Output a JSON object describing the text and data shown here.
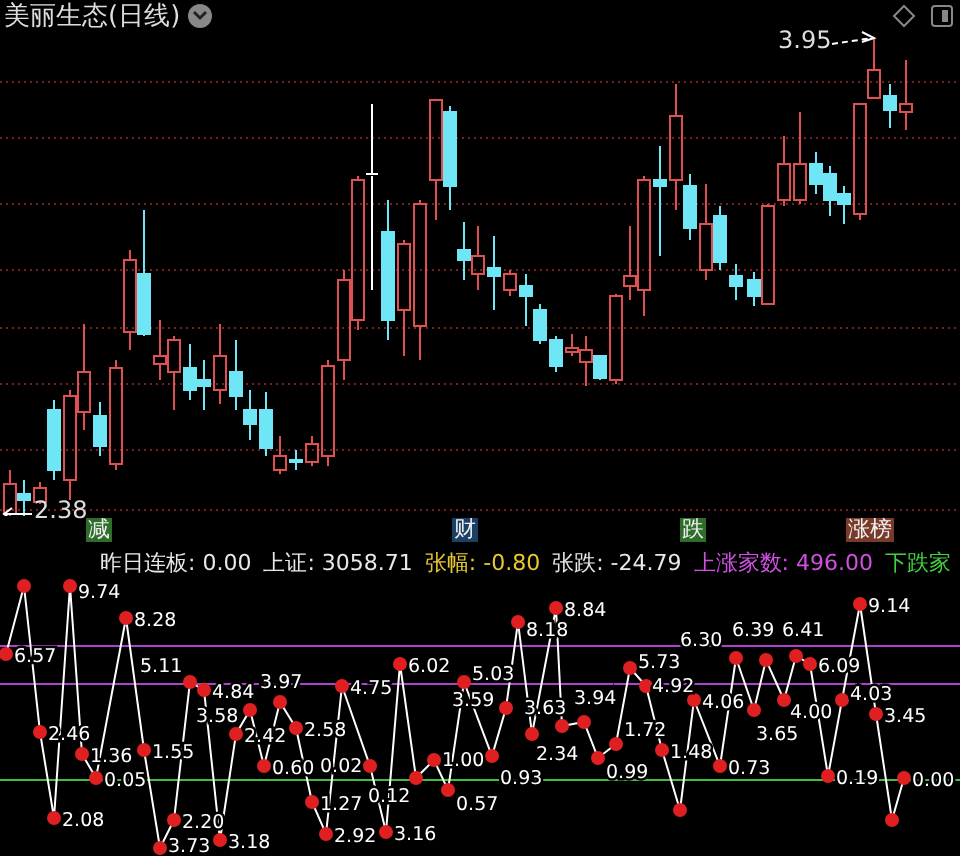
{
  "chart": {
    "title": "美丽生态(日线)",
    "high_label": "3.95",
    "low_label": "2.38"
  },
  "markers": [
    {
      "label": "减",
      "color": "#2f6e2a"
    },
    {
      "label": "财",
      "color": "#1c3f66"
    },
    {
      "label": "跌",
      "color": "#2f6e2a"
    },
    {
      "label": "涨榜",
      "color": "#7a3a2a"
    }
  ],
  "indicator": {
    "readouts": [
      {
        "text": "昨日连板: 0.00",
        "color": "#e8e8e8"
      },
      {
        "text": "上证: 3058.71",
        "color": "#e8e8e8"
      },
      {
        "text": "张幅: -0.80",
        "color": "#e8c830"
      },
      {
        "text": "张跌: -24.79",
        "color": "#e8e8e8"
      },
      {
        "text": "上涨家数: 496.00",
        "color": "#d050e0"
      },
      {
        "text": "下跌家",
        "color": "#40d040"
      }
    ],
    "point_labels": [
      "6.57",
      "2.46",
      "2.08",
      "9.74",
      "1.36",
      "0.05",
      "8.28",
      "1.55",
      "3.73",
      "2.20",
      "5.11",
      "4.84",
      "3.18",
      "2.42",
      "3.58",
      "0.60",
      "3.97",
      "2.58",
      "1.27",
      "2.92",
      "4.75",
      "0.02",
      "3.16",
      "6.02",
      "0.12",
      "1.00",
      "0.57",
      "5.03",
      "0.93",
      "3.59",
      "8.18",
      "2.34",
      "8.84",
      "3.63",
      "3.94",
      "0.99",
      "1.72",
      "5.73",
      "4.92",
      "1.48",
      "4.06",
      "0.73",
      "6.30",
      "3.65",
      "6.39",
      "4.00",
      "6.41",
      "6.09",
      "0.19",
      "4.03",
      "9.14",
      "3.45",
      "0.00"
    ]
  }
}
